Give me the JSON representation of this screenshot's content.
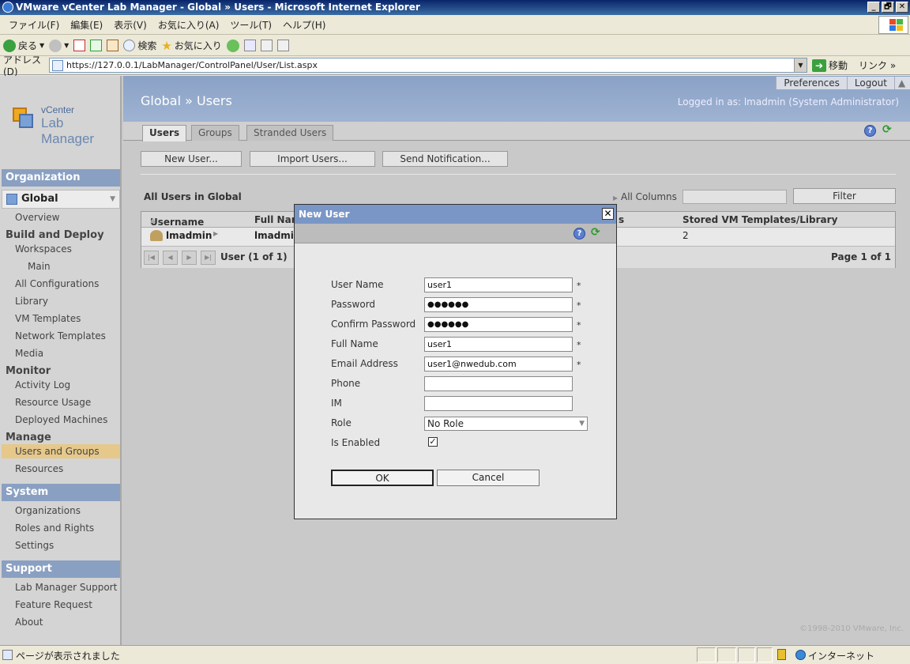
{
  "window": {
    "title": "VMware vCenter Lab Manager - Global » Users - Microsoft Internet Explorer",
    "controls": [
      "_",
      "🗗",
      "✕"
    ]
  },
  "menu": [
    "ファイル(F)",
    "編集(E)",
    "表示(V)",
    "お気に入り(A)",
    "ツール(T)",
    "ヘルプ(H)"
  ],
  "toolbar": {
    "back": "戻る",
    "search": "検索",
    "favorites": "お気に入り"
  },
  "address": {
    "label": "アドレス(D)",
    "url": "https://127.0.0.1/LabManager/ControlPanel/User/List.aspx",
    "go": "移動",
    "links": "リンク »"
  },
  "logo": {
    "line1": "vCenter",
    "line2": "Lab Manager"
  },
  "header": {
    "preferences": "Preferences",
    "logout": "Logout",
    "title": "Global » Users",
    "logged_in": "Logged in as: lmadmin (System Administrator)"
  },
  "sidebar": {
    "organization": "Organization",
    "global": "Global",
    "overview": "Overview",
    "build_deploy": "Build and Deploy",
    "workspaces": "Workspaces",
    "main": "Main",
    "all_configurations": "All Configurations",
    "library": "Library",
    "vm_templates": "VM Templates",
    "network_templates": "Network Templates",
    "media": "Media",
    "monitor": "Monitor",
    "activity_log": "Activity Log",
    "resource_usage": "Resource Usage",
    "deployed_machines": "Deployed Machines",
    "manage": "Manage",
    "users_groups": "Users and Groups",
    "resources": "Resources",
    "system": "System",
    "organizations": "Organizations",
    "roles_rights": "Roles and Rights",
    "settings": "Settings",
    "support": "Support",
    "lm_support": "Lab Manager Support",
    "feature_request": "Feature Request",
    "about": "About"
  },
  "tabs": {
    "users": "Users",
    "groups": "Groups",
    "stranded": "Stranded Users"
  },
  "actions": {
    "new_user": "New User...",
    "import_users": "Import Users...",
    "send_notification": "Send Notification...",
    "filter": "Filter"
  },
  "list": {
    "heading": "All Users in Global",
    "all_columns": "All Columns",
    "col_username": "Username",
    "col_fullname": "Full Nam",
    "col_s": "s",
    "col_stored": "Stored VM Templates/Library",
    "row_username": "lmadmin",
    "row_fullname": "lmadmin",
    "row_stored": "2",
    "pager_text": "User (1 of 1)",
    "page_text": "Page 1 of 1"
  },
  "modal": {
    "title": "New User",
    "labels": {
      "username": "User Name",
      "password": "Password",
      "confirm": "Confirm Password",
      "fullname": "Full Name",
      "email": "Email Address",
      "phone": "Phone",
      "im": "IM",
      "role": "Role",
      "enabled": "Is Enabled"
    },
    "values": {
      "username": "user1",
      "password": "●●●●●●",
      "confirm": "●●●●●●",
      "fullname": "user1",
      "email": "user1@nwedub.com",
      "phone": "",
      "im": "",
      "role": "No Role"
    },
    "required_mark": "*",
    "ok": "OK",
    "cancel": "Cancel"
  },
  "copyright": "©1998-2010 VMware, Inc.",
  "status": {
    "text": "ページが表示されました",
    "zone": "インターネット"
  },
  "colors": {
    "header": "#8aa2c6",
    "sidebar_section": "#8aa0c2",
    "active_nav": "#e6c88a",
    "modal_title": "#7a96c6"
  }
}
